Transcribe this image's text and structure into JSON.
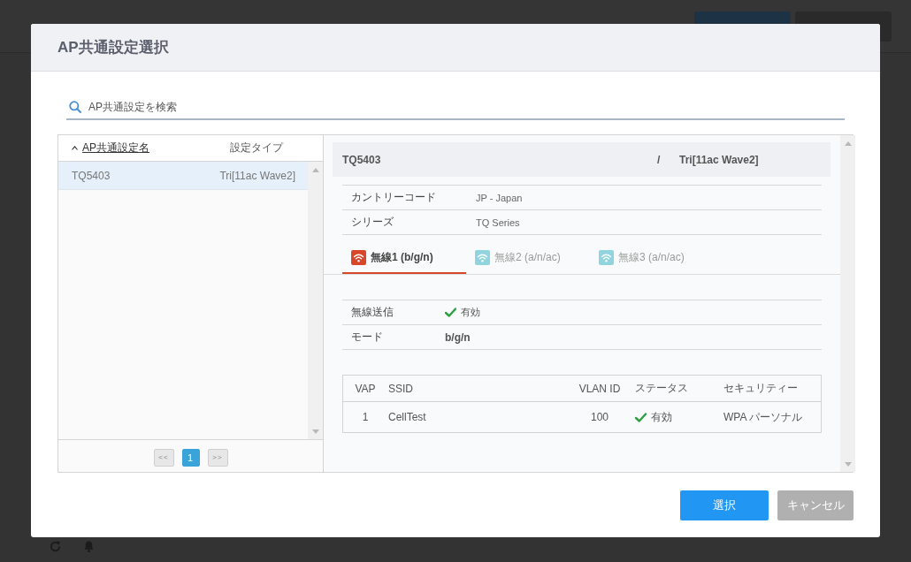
{
  "dialog": {
    "title": "AP共通設定選択",
    "search": {
      "placeholder": "AP共通設定を検索"
    },
    "list": {
      "columns": [
        {
          "label": "AP共通設定名",
          "sorted": true
        },
        {
          "label": "設定タイプ",
          "sorted": false
        }
      ],
      "rows": [
        {
          "name": "TQ5403",
          "type": "Tri[11ac Wave2]",
          "selected": true
        }
      ],
      "pagination": {
        "previous": "<<",
        "pages": [
          {
            "label": "1",
            "selected": true
          }
        ],
        "next": ">>"
      }
    },
    "detail": {
      "name": "TQ5403",
      "separator": "/",
      "type": "Tri[11ac Wave2]",
      "info": [
        {
          "label": "カントリーコード",
          "value": "JP - Japan"
        },
        {
          "label": "シリーズ",
          "value": "TQ Series"
        }
      ],
      "tabs": [
        {
          "label": "無線1 (b/g/n)",
          "selected": true
        },
        {
          "label": "無線2 (a/n/ac)",
          "selected": false
        },
        {
          "label": "無線3 (a/n/ac)",
          "selected": false
        }
      ],
      "settings": [
        {
          "label": "無線送信",
          "kind": "status",
          "enabled": true,
          "value": "有効"
        },
        {
          "label": "モード",
          "kind": "text",
          "value": "b/g/n"
        }
      ],
      "vap_table": {
        "columns": [
          "VAP",
          "SSID",
          "VLAN ID",
          "ステータス",
          "セキュリティー"
        ],
        "rows": [
          {
            "vap": "1",
            "ssid": "CellTest",
            "vlan_id": "100",
            "enabled": true,
            "status": "有効",
            "security": "WPA パーソナル"
          }
        ]
      }
    },
    "buttons": [
      {
        "label": "選択",
        "kind": "primary"
      },
      {
        "label": "キャンセル",
        "kind": "secondary"
      }
    ]
  }
}
